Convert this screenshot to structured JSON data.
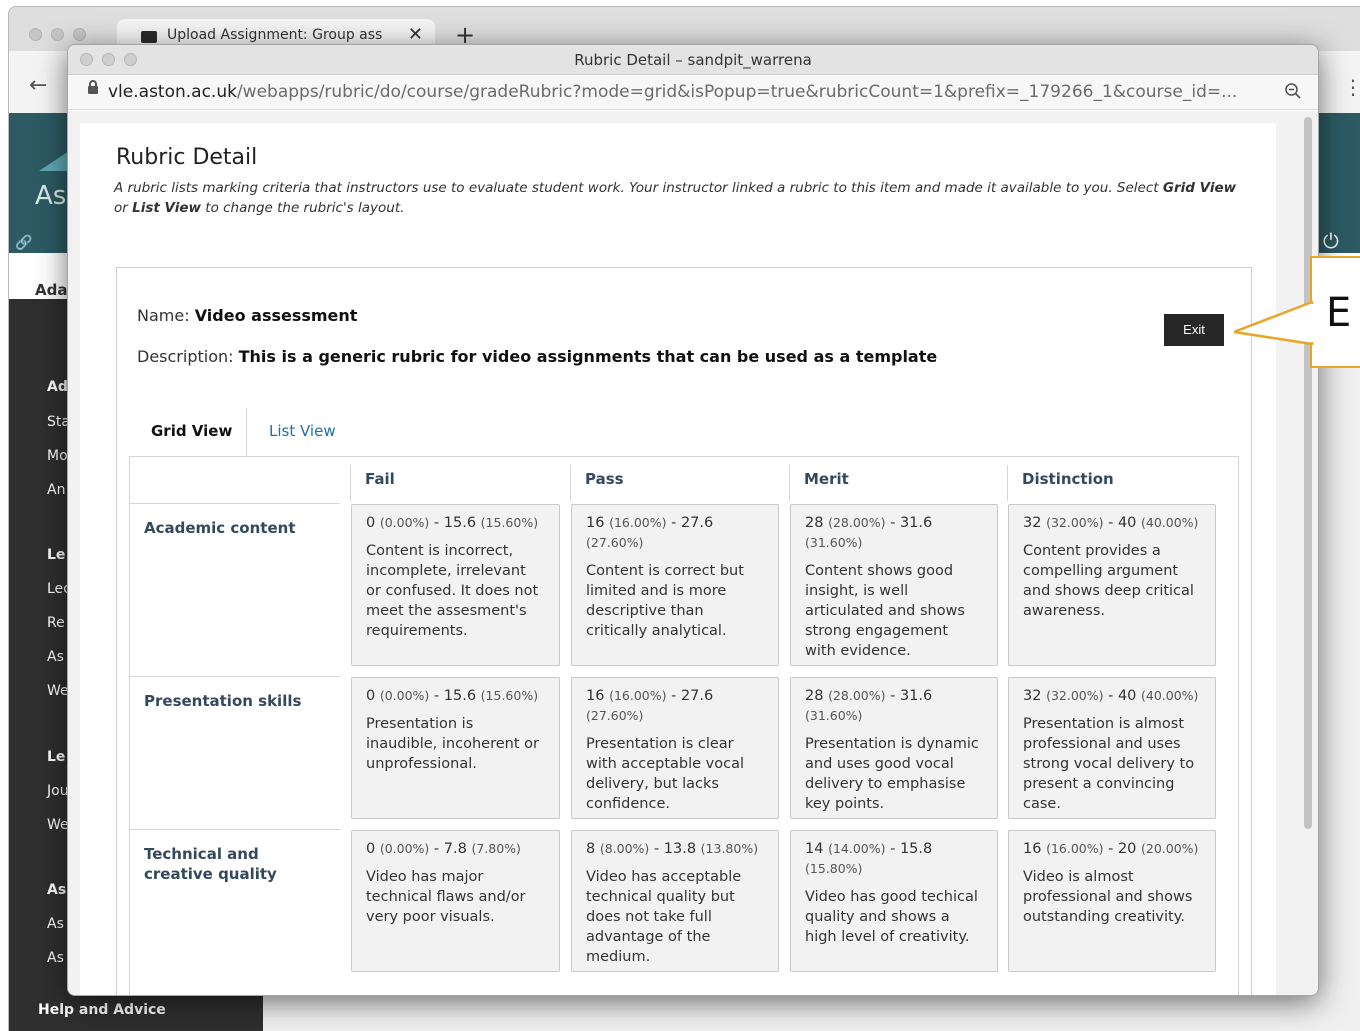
{
  "background": {
    "tab_title": "Upload Assignment: Group ass",
    "tab_close": "✕",
    "new_tab": "+",
    "back": "←",
    "kebab": "⋮",
    "banner_text": "As",
    "link_icon": "🔗",
    "power_icon": "⏻",
    "whitebar_text": "Ada",
    "sidebar": [
      "Ad",
      "Sta",
      "Mo",
      "An",
      "Le",
      "Lec",
      "Re",
      "As",
      "We",
      "Le",
      "Jou",
      "We",
      "As",
      "As",
      "As"
    ],
    "help": "Help and Advice"
  },
  "popup": {
    "window_title": "Rubric Detail – sandpit_warrena",
    "url_host": "vle.aston.ac.uk",
    "url_path": "/webapps/rubric/do/course/gradeRubric?mode=grid&isPopup=true&rubricCount=1&prefix=_179266_1&course_id=..."
  },
  "page": {
    "title": "Rubric Detail",
    "intro_1": "A rubric lists marking criteria that instructors use to evaluate student work. Your instructor linked a rubric to this item and made it available to you. Select ",
    "intro_grid": "Grid View",
    "intro_2": " or ",
    "intro_list": "List View",
    "intro_3": " to change the rubric's layout."
  },
  "rubric": {
    "name_label": "Name: ",
    "name": "Video assessment",
    "description_label": "Description: ",
    "description": "This is a generic rubric for video assignments that can be used as a template",
    "exit_label": "Exit",
    "tabs": [
      {
        "label": "Grid View",
        "active": true
      },
      {
        "label": "List View",
        "active": false
      }
    ],
    "columns": [
      "Fail",
      "Pass",
      "Merit",
      "Distinction"
    ],
    "rows": [
      {
        "criterion": "Academic content",
        "cells": [
          {
            "lo": "0",
            "lo_pct": "(0.00%)",
            "hi": "15.6",
            "hi_pct": "(15.60%)",
            "desc": "Content is incorrect, incomplete, irrelevant or confused. It does not meet the assesment's requirements."
          },
          {
            "lo": "16",
            "lo_pct": "(16.00%)",
            "hi": "27.6",
            "hi_pct": "(27.60%)",
            "desc": "Content is correct but limited and is more descriptive than critically analytical."
          },
          {
            "lo": "28",
            "lo_pct": "(28.00%)",
            "hi": "31.6",
            "hi_pct": "(31.60%)",
            "desc": "Content shows good insight, is well articulated and shows strong engagement with evidence."
          },
          {
            "lo": "32",
            "lo_pct": "(32.00%)",
            "hi": "40",
            "hi_pct": "(40.00%)",
            "desc": "Content provides a compelling argument and shows deep critical awareness."
          }
        ]
      },
      {
        "criterion": "Presentation skills",
        "cells": [
          {
            "lo": "0",
            "lo_pct": "(0.00%)",
            "hi": "15.6",
            "hi_pct": "(15.60%)",
            "desc": "Presentation is inaudible, incoherent or unprofessional."
          },
          {
            "lo": "16",
            "lo_pct": "(16.00%)",
            "hi": "27.6",
            "hi_pct": "(27.60%)",
            "desc": "Presentation is clear with acceptable vocal delivery, but lacks confidence."
          },
          {
            "lo": "28",
            "lo_pct": "(28.00%)",
            "hi": "31.6",
            "hi_pct": "(31.60%)",
            "desc": "Presentation is dynamic and uses good vocal delivery to emphasise key points."
          },
          {
            "lo": "32",
            "lo_pct": "(32.00%)",
            "hi": "40",
            "hi_pct": "(40.00%)",
            "desc": "Presentation is almost professional and uses strong vocal delivery to present a convincing case."
          }
        ]
      },
      {
        "criterion": "Technical and creative quality",
        "cells": [
          {
            "lo": "0",
            "lo_pct": "(0.00%)",
            "hi": "7.8",
            "hi_pct": "(7.80%)",
            "desc": "Video has major technical flaws and/or very poor visuals."
          },
          {
            "lo": "8",
            "lo_pct": "(8.00%)",
            "hi": "13.8",
            "hi_pct": "(13.80%)",
            "desc": "Video has acceptable technical quality but does not take full advantage of the medium."
          },
          {
            "lo": "14",
            "lo_pct": "(14.00%)",
            "hi": "15.8",
            "hi_pct": "(15.80%)",
            "desc": "Video has good techical quality and shows a high level of creativity."
          },
          {
            "lo": "16",
            "lo_pct": "(16.00%)",
            "hi": "20",
            "hi_pct": "(20.00%)",
            "desc": "Video is almost professional and shows outstanding creativity."
          }
        ]
      }
    ]
  },
  "callout": {
    "text": "E",
    "color": "#e6a62a"
  }
}
